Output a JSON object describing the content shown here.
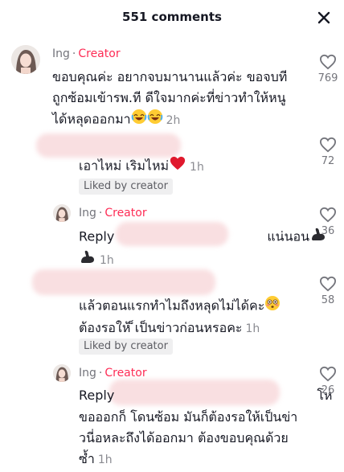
{
  "header": {
    "title": "551 comments"
  },
  "comments": [
    {
      "author": "Ing",
      "badge": "Creator",
      "lines": [
        "ขอบคุณค่ะ อยากจบมานานแล้วค่ะ ขอจบที",
        "ถูกซ้อมเข้ารพ.ที ดีใจมากค่ะที่ข่าวทำให้หนู",
        "ได้หลุดออกมา"
      ],
      "time": "2h",
      "likes": "769"
    },
    {
      "text": "เอาไหม่ เริมไหม่",
      "time": "1h",
      "liked_label": "Liked by creator",
      "likes": "72"
    },
    {
      "author": "Ing",
      "badge": "Creator",
      "reply_label": "Reply",
      "text_tail": "แน่นอน",
      "time": "1h",
      "likes": "36"
    },
    {
      "lines": [
        "แล้วตอนแรกทำไมถึงหลุดไม่ได้คะ",
        "ต้องรอให้ ็เป็นข่าวก่อนหรอคะ"
      ],
      "time": "1h",
      "liked_label": "Liked by creator",
      "likes": "58"
    },
    {
      "author": "Ing",
      "badge": "Creator",
      "reply_label": "Reply",
      "text_tail": "โห",
      "lines": [
        "ขอออกก็ โดนซ้อม มันก็ต้องรอให้เป็นข่า",
        "วนี่อหละถึงได้ออกมา ต้องขอบคุณด้วย",
        "ซ้ำ"
      ],
      "time": "1h",
      "likes": "26"
    }
  ],
  "icons": {
    "close": "close-icon",
    "like": "heart-outline-icon"
  },
  "colors": {
    "creator": "#fe2c55",
    "muted": "#73747b"
  }
}
